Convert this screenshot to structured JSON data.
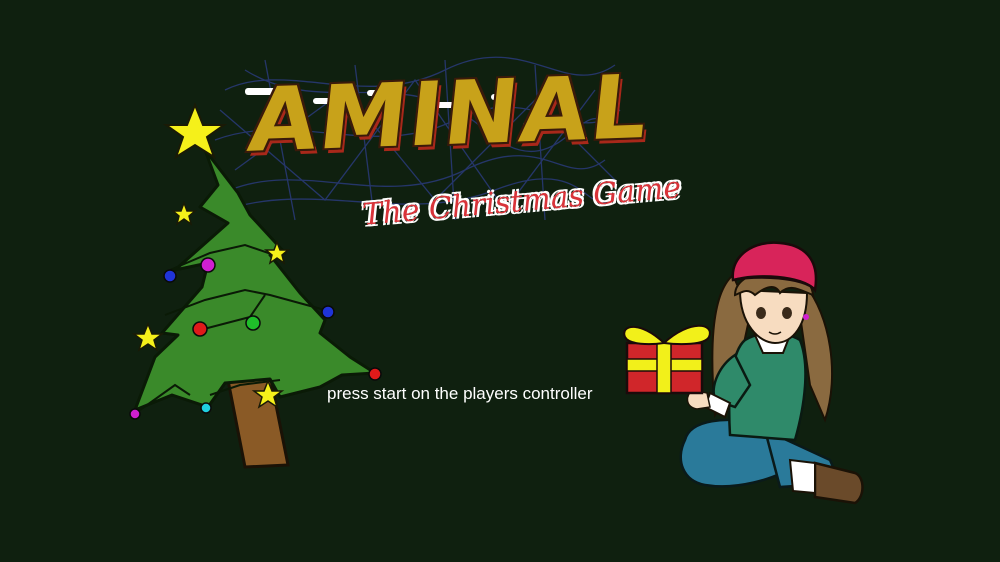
{
  "screen": {
    "background": "#0f200f",
    "logo": {
      "wordmark": "AMINAL",
      "subtitle": "The Christmas Game",
      "wordmark_color": "#c8a21a",
      "subtitle_color": "#d8343a"
    },
    "prompt": "press start on the players controller",
    "art": {
      "tree": "christmas-tree-illustration",
      "character": "girl-holding-gift-illustration"
    }
  }
}
